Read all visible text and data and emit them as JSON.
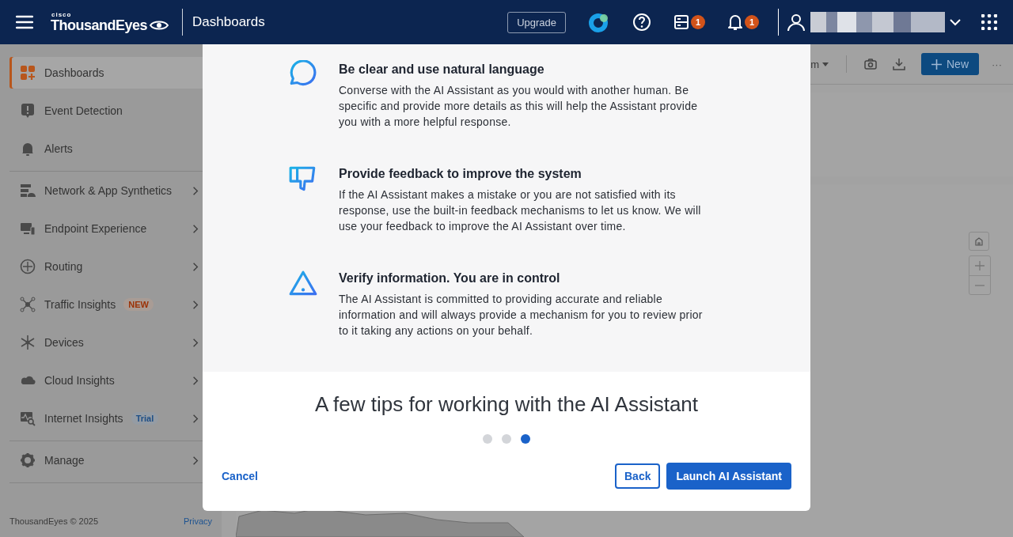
{
  "header": {
    "logo_small": "cisco",
    "logo": "ThousandEyes",
    "page_title": "Dashboards",
    "upgrade_button": "Upgrade",
    "server_badge": "1",
    "bell_badge": "1"
  },
  "sidebar": {
    "groups": [
      [
        {
          "label": "Dashboards",
          "selected": true,
          "has_submenu": false
        },
        {
          "label": "Event Detection",
          "selected": false,
          "has_submenu": false
        },
        {
          "label": "Alerts",
          "selected": false,
          "has_submenu": false
        }
      ],
      [
        {
          "label": "Network & App Synthetics",
          "selected": false,
          "has_submenu": true
        },
        {
          "label": "Endpoint Experience",
          "selected": false,
          "has_submenu": true
        },
        {
          "label": "Routing",
          "selected": false,
          "has_submenu": true
        },
        {
          "label": "Traffic Insights",
          "selected": false,
          "has_submenu": true,
          "badge": {
            "text": "NEW",
            "kind": "new"
          }
        },
        {
          "label": "Devices",
          "selected": false,
          "has_submenu": true
        },
        {
          "label": "Cloud Insights",
          "selected": false,
          "has_submenu": true
        },
        {
          "label": "Internet Insights",
          "selected": false,
          "has_submenu": true,
          "badge": {
            "text": "Trial",
            "kind": "trial"
          }
        }
      ],
      [
        {
          "label": "Manage",
          "selected": false,
          "has_submenu": true
        }
      ]
    ],
    "footer": "ThousandEyes © 2025",
    "privacy_link": "Privacy"
  },
  "toolbar": {
    "partial_text": "m",
    "new_button": "New",
    "more": "···"
  },
  "modal": {
    "tips": [
      {
        "title": "Be clear and use natural language",
        "text": "Converse with the AI Assistant as you would with another human. Be specific and provide more details as this will help the Assistant provide you with a more helpful response."
      },
      {
        "title": "Provide feedback to improve the system",
        "text": "If the AI Assistant makes a mistake or you are not satisfied with its response, use the built-in feedback mechanisms to let us know. We will use your feedback to improve the AI Assistant over time."
      },
      {
        "title": "Verify information. You are in control",
        "text": "The AI Assistant is committed to providing accurate and reliable information and will always provide a mechanism for you to review prior to it taking any actions on your behalf."
      }
    ],
    "title": "A few tips for working with the AI Assistant",
    "steps": [
      {
        "selected": false
      },
      {
        "selected": false
      },
      {
        "selected": true
      }
    ],
    "cancel_button": "Cancel",
    "back_button": "Back",
    "launch_button": "Launch AI Assistant"
  }
}
